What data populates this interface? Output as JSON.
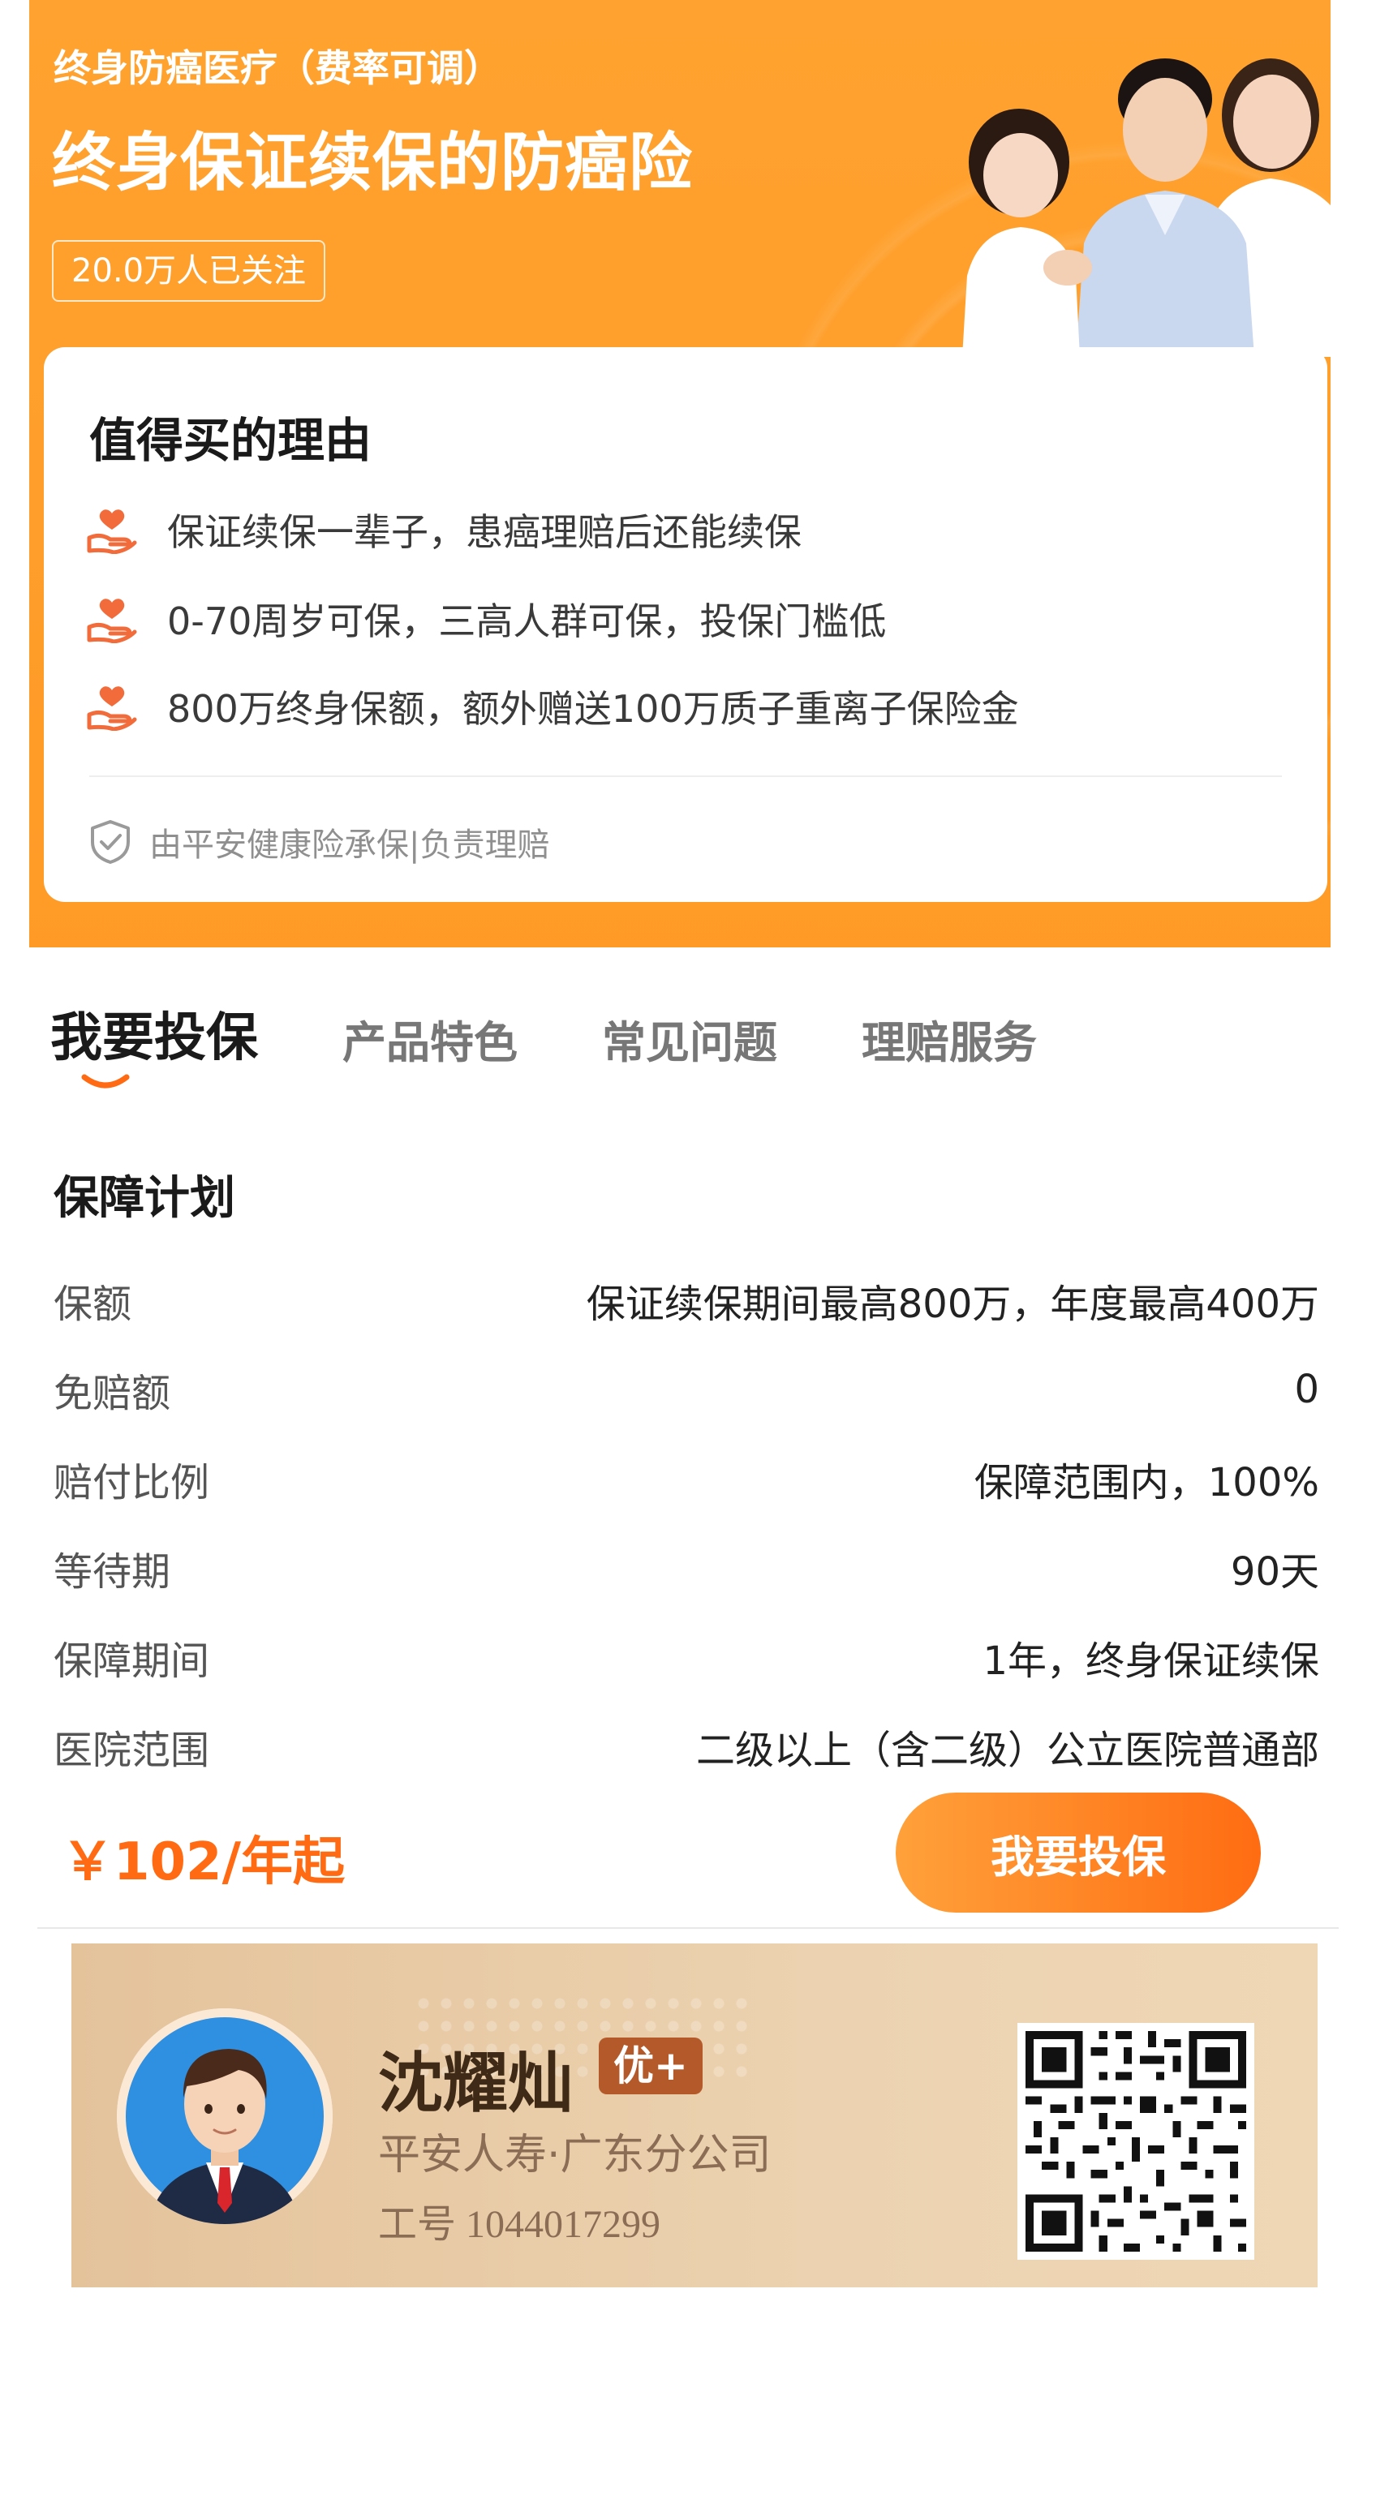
{
  "hero": {
    "subtitle": "终身防癌医疗（费率可调）",
    "title": "终身保证续保的防癌险",
    "followers": "20.0万人已关注"
  },
  "reasons": {
    "title": "值得买的理由",
    "items": [
      {
        "icon": "heart-hand-icon",
        "text": "保证续保一辈子，患癌理赔后还能续保"
      },
      {
        "icon": "heart-hand-icon",
        "text": "0-70周岁可保，三高人群可保，投保门槛低"
      },
      {
        "icon": "heart-hand-icon",
        "text": "800万终身保额，额外赠送100万质子重离子保险金"
      }
    ],
    "underwriter": "由平安健康险承保|负责理赔"
  },
  "tabs": [
    {
      "label": "我要投保",
      "active": true
    },
    {
      "label": "产品特色",
      "active": false
    },
    {
      "label": "常见问题",
      "active": false
    },
    {
      "label": "理赔服务",
      "active": false
    }
  ],
  "plan": {
    "title": "保障计划",
    "rows": [
      {
        "key": "保额",
        "value": "保证续保期间最高800万，年度最高400万"
      },
      {
        "key": "免赔额",
        "value": "0"
      },
      {
        "key": "赔付比例",
        "value": "保障范围内，100%"
      },
      {
        "key": "等待期",
        "value": "90天"
      },
      {
        "key": "保障期间",
        "value": "1年，终身保证续保"
      },
      {
        "key": "医院范围",
        "value": "二级以上（含二级）公立医院普通部"
      }
    ]
  },
  "purchase": {
    "price": "￥102/年起",
    "button": "我要投保"
  },
  "agent": {
    "name": "沈耀灿",
    "tag": "优+",
    "company": "平安人寿·广东分公司",
    "employee_id": "工号 1044017299"
  },
  "colors": {
    "brand_orange": "#ff9a26",
    "accent_orange": "#ff6a12",
    "agent_card": "#e8c9a3"
  }
}
